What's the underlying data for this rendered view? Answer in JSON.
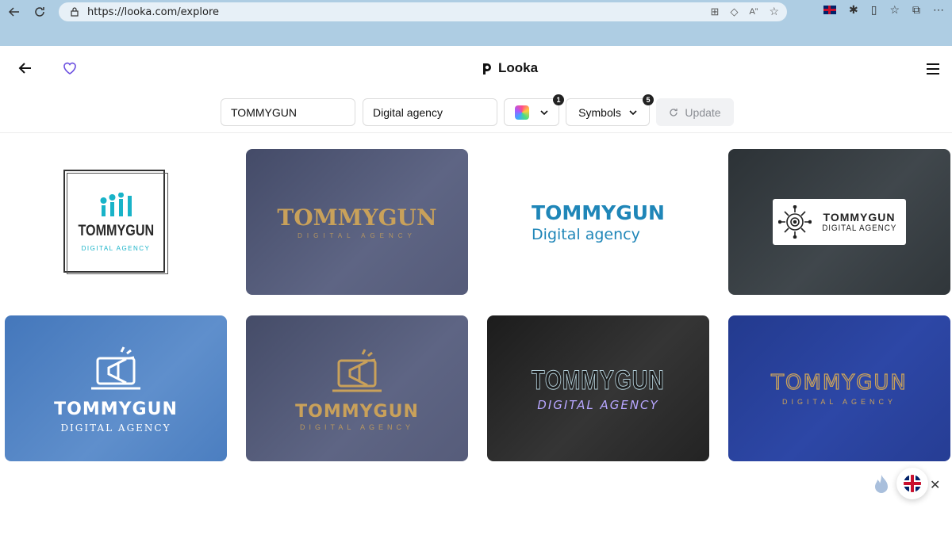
{
  "browser": {
    "url": "https://looka.com/explore"
  },
  "header": {
    "brand": "Looka"
  },
  "toolbar": {
    "company_name": "TOMMYGUN",
    "industry": "Digital agency",
    "color_badge": "1",
    "symbols_label": "Symbols",
    "symbols_badge": "5",
    "update_label": "Update"
  },
  "logos": [
    {
      "name": "TOMMYGUN",
      "tagline": "DIGITAL AGENCY",
      "icon": "money-arrows-icon",
      "accent": "#19b3c8"
    },
    {
      "name": "TOMMYGUN",
      "tagline": "DIGITAL AGENCY",
      "icon": "none",
      "accent": "#c9a15a"
    },
    {
      "name": "TOMMYGUN",
      "tagline": "Digital agency",
      "icon": "none",
      "accent": "#1f86b8"
    },
    {
      "name": "TOMMYGUN",
      "tagline": "DIGITAL AGENCY",
      "icon": "target-circuit-icon",
      "accent": "#222222"
    },
    {
      "name": "TOMMYGUN",
      "tagline": "DIGITAL AGENCY",
      "icon": "megaphone-laptop-icon",
      "accent": "#ffffff"
    },
    {
      "name": "TOMMYGUN",
      "tagline": "DIGITAL AGENCY",
      "icon": "megaphone-laptop-icon",
      "accent": "#c9a15a"
    },
    {
      "name": "TOMMYGUN",
      "tagline": "DIGITAL AGENCY",
      "icon": "none",
      "accent": "#b7a6ff"
    },
    {
      "name": "TOMMYGUN",
      "tagline": "DIGITAL AGENCY",
      "icon": "none",
      "accent": "#c9a15a"
    }
  ]
}
